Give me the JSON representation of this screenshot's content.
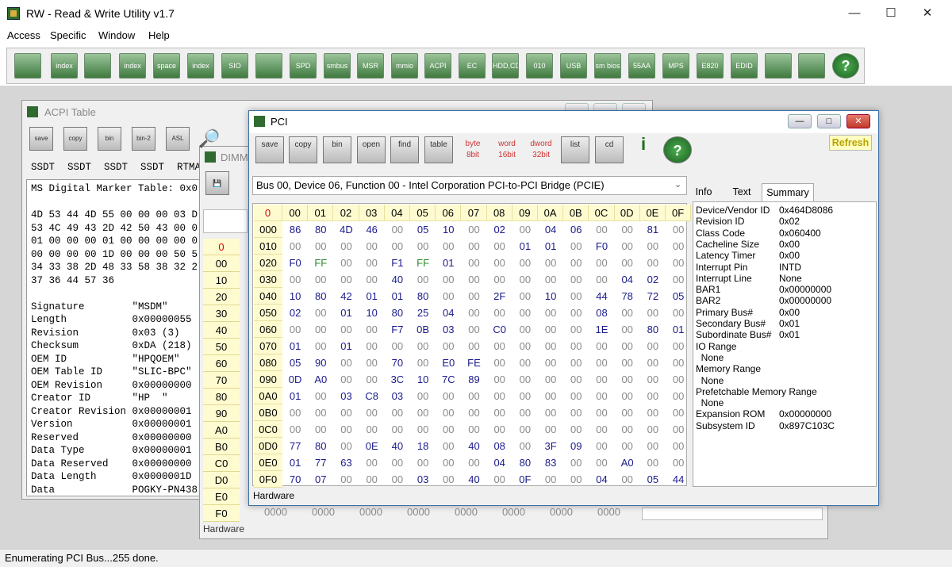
{
  "app": {
    "title": "RW - Read & Write Utility v1.7",
    "status": "Enumerating PCI Bus...255 done."
  },
  "menu": [
    "Access",
    "Specific",
    "Window",
    "Help"
  ],
  "toolbar_icons": [
    "memory",
    "index",
    "memory-2",
    "index-2",
    "space",
    "index-3",
    "sio",
    "scope",
    "spd",
    "smbus",
    "msr",
    "mmio",
    "acpi",
    "ec",
    "hdd-cd",
    "disk",
    "usb",
    "smbios",
    "55aa",
    "mps",
    "e820",
    "edid",
    "cmd",
    "pci-card",
    "help"
  ],
  "toolbar_labels": [
    "",
    "index",
    "",
    "index",
    "space",
    "index",
    "SIO",
    "",
    "SPD",
    "smbus",
    "MSR",
    "mmio",
    "ACPI",
    "EC",
    "HDD,CD",
    "010",
    "USB",
    "sm bios",
    "55AA",
    "MPS",
    "E820",
    "EDID",
    "",
    "",
    "?"
  ],
  "acpi": {
    "title": "ACPI Table",
    "tabs": [
      "SSDT",
      "SSDT",
      "SSDT",
      "SSDT",
      "RTMA"
    ],
    "tools": [
      "save",
      "copy",
      "bin",
      "bin-2",
      "ASL"
    ],
    "content": "MS Digital Marker Table: 0x0\n\n4D 53 44 4D 55 00 00 00 03 D\n53 4C 49 43 2D 42 50 43 00 0\n01 00 00 00 01 00 00 00 00 0\n00 00 00 00 1D 00 00 00 50 5\n34 33 38 2D 48 33 58 38 32 2\n37 36 44 57 36\n\nSignature        \"MSDM\"\nLength           0x00000055\nRevision         0x03 (3)\nChecksum         0xDA (218)\nOEM ID           \"HPQOEM\"\nOEM Table ID     \"SLIC-BPC\"\nOEM Revision     0x00000000\nCreator ID       \"HP  \"\nCreator Revision 0x00000001\nVersion          0x00000001\nReserved         0x00000000\nData Type        0x00000001\nData Reserved    0x00000000\nData Length      0x0000001D\nData             POGKY-PN438"
  },
  "dimm": {
    "title": "DIMM",
    "row_labels": [
      "0",
      "00",
      "10",
      "20",
      "30",
      "40",
      "50",
      "60",
      "70",
      "80",
      "90",
      "A0",
      "B0",
      "C0",
      "D0",
      "E0",
      "F0"
    ],
    "bottom_values": [
      "0000",
      "0000",
      "0000",
      "0000",
      "0000",
      "0000",
      "0000",
      "0000"
    ],
    "footer": "Hardware"
  },
  "pci": {
    "title": "PCI",
    "refresh": "Refresh",
    "tools": [
      "save",
      "copy",
      "bin",
      "open",
      "find",
      "table",
      "byte 8bit",
      "word 16bit",
      "dword 32bit",
      "list",
      "cd",
      "info",
      "help"
    ],
    "device": "Bus 00, Device 06, Function 00 - Intel Corporation PCI-to-PCI Bridge (PCIE)",
    "columns": [
      "0",
      "00",
      "01",
      "02",
      "03",
      "04",
      "05",
      "06",
      "07",
      "08",
      "09",
      "0A",
      "0B",
      "0C",
      "0D",
      "0E",
      "0F"
    ],
    "rows": [
      {
        "label": "000",
        "cells": [
          "86",
          "80",
          "4D",
          "46",
          "00",
          "05",
          "10",
          "00",
          "02",
          "00",
          "04",
          "06",
          "00",
          "00",
          "81",
          "00"
        ]
      },
      {
        "label": "010",
        "cells": [
          "00",
          "00",
          "00",
          "00",
          "00",
          "00",
          "00",
          "00",
          "00",
          "01",
          "01",
          "00",
          "F0",
          "00",
          "00",
          "00"
        ]
      },
      {
        "label": "020",
        "cells": [
          "F0",
          "FF",
          "00",
          "00",
          "F1",
          "FF",
          "01",
          "00",
          "00",
          "00",
          "00",
          "00",
          "00",
          "00",
          "00",
          "00"
        ]
      },
      {
        "label": "030",
        "cells": [
          "00",
          "00",
          "00",
          "00",
          "40",
          "00",
          "00",
          "00",
          "00",
          "00",
          "00",
          "00",
          "00",
          "04",
          "02",
          "00"
        ]
      },
      {
        "label": "040",
        "cells": [
          "10",
          "80",
          "42",
          "01",
          "01",
          "80",
          "00",
          "00",
          "2F",
          "00",
          "10",
          "00",
          "44",
          "78",
          "72",
          "05"
        ]
      },
      {
        "label": "050",
        "cells": [
          "02",
          "00",
          "01",
          "10",
          "80",
          "25",
          "04",
          "00",
          "00",
          "00",
          "00",
          "00",
          "08",
          "00",
          "00",
          "00"
        ]
      },
      {
        "label": "060",
        "cells": [
          "00",
          "00",
          "00",
          "00",
          "F7",
          "0B",
          "03",
          "00",
          "C0",
          "00",
          "00",
          "00",
          "1E",
          "00",
          "80",
          "01"
        ]
      },
      {
        "label": "070",
        "cells": [
          "01",
          "00",
          "01",
          "00",
          "00",
          "00",
          "00",
          "00",
          "00",
          "00",
          "00",
          "00",
          "00",
          "00",
          "00",
          "00"
        ]
      },
      {
        "label": "080",
        "cells": [
          "05",
          "90",
          "00",
          "00",
          "70",
          "00",
          "E0",
          "FE",
          "00",
          "00",
          "00",
          "00",
          "00",
          "00",
          "00",
          "00"
        ]
      },
      {
        "label": "090",
        "cells": [
          "0D",
          "A0",
          "00",
          "00",
          "3C",
          "10",
          "7C",
          "89",
          "00",
          "00",
          "00",
          "00",
          "00",
          "00",
          "00",
          "00"
        ]
      },
      {
        "label": "0A0",
        "cells": [
          "01",
          "00",
          "03",
          "C8",
          "03",
          "00",
          "00",
          "00",
          "00",
          "00",
          "00",
          "00",
          "00",
          "00",
          "00",
          "00"
        ]
      },
      {
        "label": "0B0",
        "cells": [
          "00",
          "00",
          "00",
          "00",
          "00",
          "00",
          "00",
          "00",
          "00",
          "00",
          "00",
          "00",
          "00",
          "00",
          "00",
          "00"
        ]
      },
      {
        "label": "0C0",
        "cells": [
          "00",
          "00",
          "00",
          "00",
          "00",
          "00",
          "00",
          "00",
          "00",
          "00",
          "00",
          "00",
          "00",
          "00",
          "00",
          "00"
        ]
      },
      {
        "label": "0D0",
        "cells": [
          "77",
          "80",
          "00",
          "0E",
          "40",
          "18",
          "00",
          "40",
          "08",
          "00",
          "3F",
          "09",
          "00",
          "00",
          "00",
          "00"
        ]
      },
      {
        "label": "0E0",
        "cells": [
          "01",
          "77",
          "63",
          "00",
          "00",
          "00",
          "00",
          "00",
          "04",
          "80",
          "83",
          "00",
          "00",
          "A0",
          "00",
          "00"
        ]
      },
      {
        "label": "0F0",
        "cells": [
          "70",
          "07",
          "00",
          "00",
          "00",
          "03",
          "00",
          "40",
          "00",
          "0F",
          "00",
          "00",
          "04",
          "00",
          "05",
          "44"
        ]
      }
    ],
    "footer": "Hardware",
    "tabs": [
      "Info",
      "Text",
      "Summary"
    ],
    "summary": [
      {
        "k": "Device/Vendor ID",
        "v": "0x464D8086"
      },
      {
        "k": "Revision ID",
        "v": "0x02"
      },
      {
        "k": "Class Code",
        "v": "0x060400"
      },
      {
        "k": "Cacheline Size",
        "v": "0x00"
      },
      {
        "k": "Latency Timer",
        "v": "0x00"
      },
      {
        "k": "Interrupt Pin",
        "v": "INTD"
      },
      {
        "k": "Interrupt Line",
        "v": "None"
      },
      {
        "k": "BAR1",
        "v": "0x00000000"
      },
      {
        "k": "BAR2",
        "v": "0x00000000"
      },
      {
        "k": "Primary Bus#",
        "v": "0x00"
      },
      {
        "k": "Secondary Bus#",
        "v": "0x01"
      },
      {
        "k": "Subordinate Bus#",
        "v": "0x01"
      },
      {
        "k": "IO Range",
        "v": ""
      },
      {
        "k": "  None",
        "v": ""
      },
      {
        "k": "Memory Range",
        "v": ""
      },
      {
        "k": "  None",
        "v": ""
      },
      {
        "k": "Prefetchable Memory Range",
        "v": ""
      },
      {
        "k": "  None",
        "v": ""
      },
      {
        "k": "Expansion ROM",
        "v": "0x00000000"
      },
      {
        "k": "Subsystem ID",
        "v": "0x897C103C"
      }
    ]
  },
  "colors": {
    "hex_nonzero": "#1a1a8c",
    "hex_zero": "#8a8a8a",
    "hex_ff": "#2e8b2e",
    "header_bg": "#fffbd0",
    "col_zero": "#e00000"
  }
}
